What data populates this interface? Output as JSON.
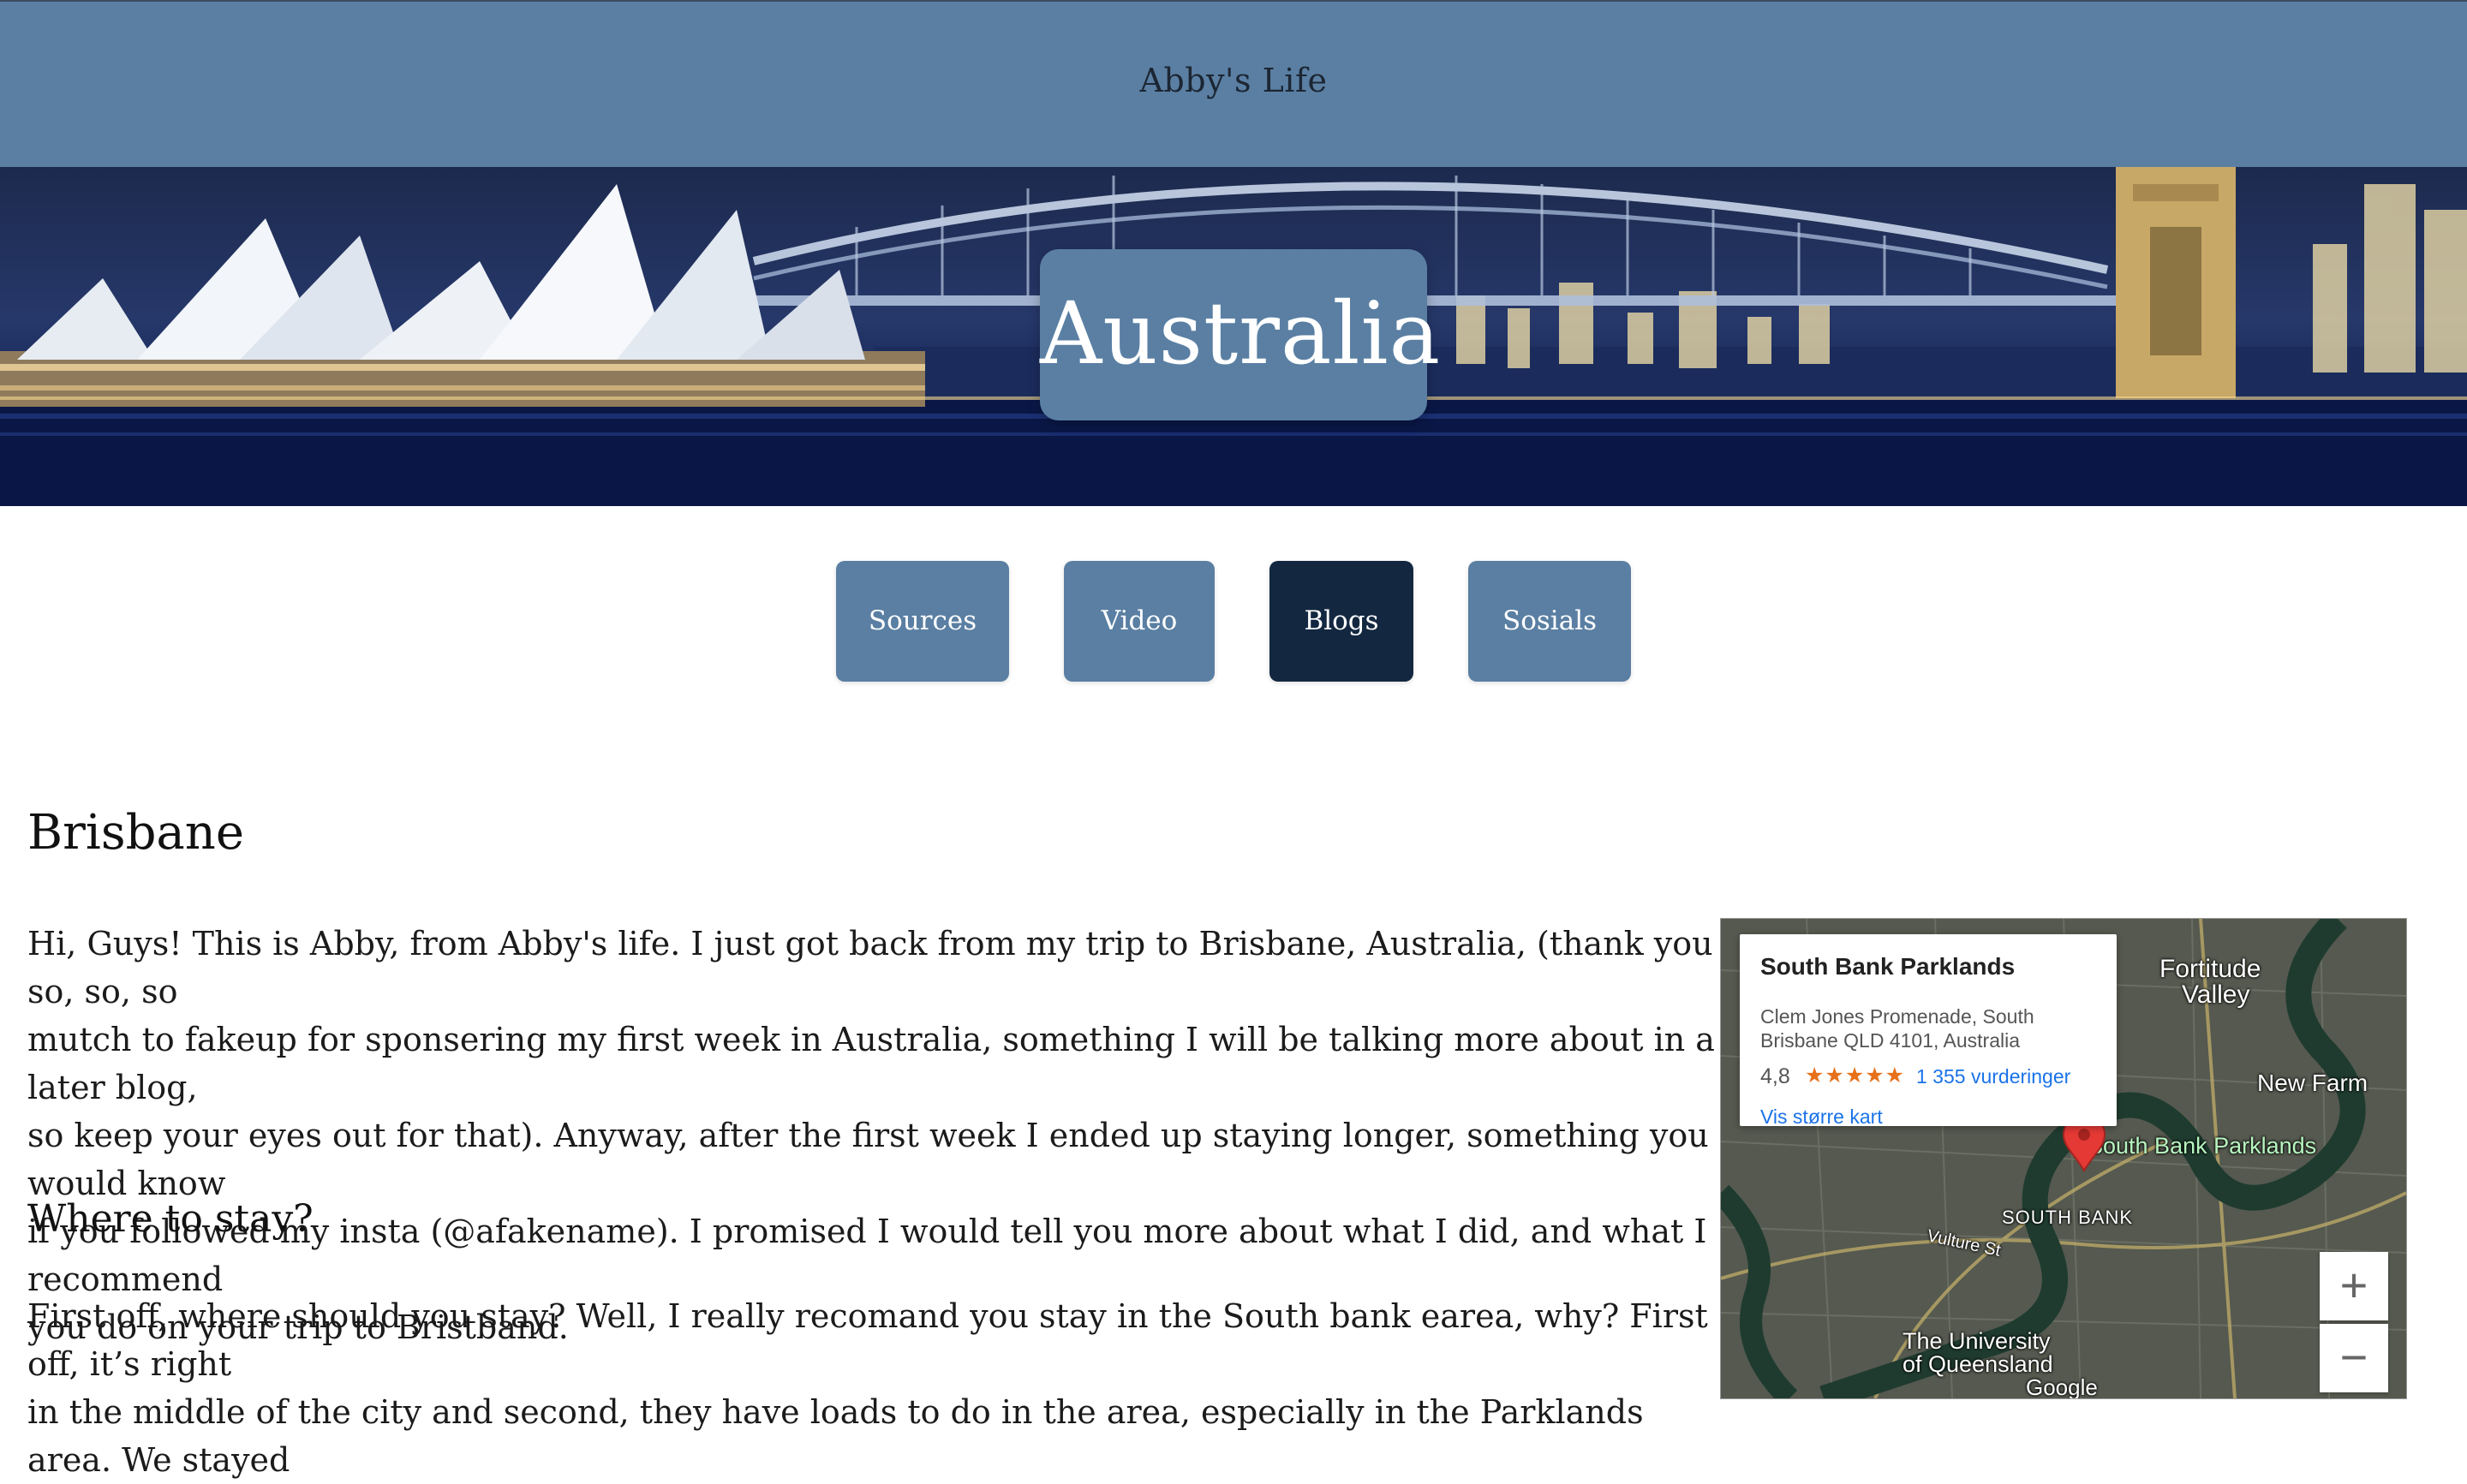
{
  "header": {
    "site_title": "Abby's Life"
  },
  "hero": {
    "title": "Australia"
  },
  "nav": {
    "items": [
      {
        "label": "Sources",
        "active": false
      },
      {
        "label": "Video",
        "active": false
      },
      {
        "label": "Blogs",
        "active": true
      },
      {
        "label": "Sosials",
        "active": false
      }
    ]
  },
  "post": {
    "title": "Brisbane",
    "intro_lines": [
      "Hi, Guys! This is Abby, from Abby's life. I just got back from my trip to Brisbane, Australia, (thank you so, so, so",
      "mutch to fakeup for sponsering my first week in Australia, something I will be talking more about in a later blog,",
      "so keep your eyes out for that). Anyway, after the first week I ended up staying longer, something you would know",
      "if you followed my insta (@afakename). I promised I would tell you more about what I did, and what I recommend",
      "you do on your trip to Bristband."
    ],
    "section_title": "Where to stay?",
    "section_lines": [
      "First off, where should you stay? Well, I really recomand you stay in the South bank earea, why? First off, it’s right",
      "in the middle of the city and second, they have loads to do in the area, especially in the Parklands area. We stayed"
    ]
  },
  "map": {
    "place_name": "South Bank Parklands",
    "address_line1": "Clem Jones Promenade, South",
    "address_line2": "Brisbane QLD 4101, Australia",
    "rating": "4,8",
    "stars": "★★★★★",
    "reviews": "1 355 vurderinger",
    "larger_map_link": "Vis større kart",
    "labels": {
      "fortitude": "Fortitude",
      "valley": "Valley",
      "new_farm": "New Farm",
      "parklands": "South Bank Parklands",
      "south_bank": "SOUTH BANK",
      "vulture": "Vulture St",
      "uq1": "The University",
      "uq2": "of Queensland",
      "google": "Google"
    },
    "zoom_in": "+",
    "zoom_out": "−"
  },
  "colors": {
    "header_bg": "#5a7fa3",
    "button_bg": "#5a7fa3",
    "button_active_bg": "#132840",
    "marker": "#e53935"
  }
}
